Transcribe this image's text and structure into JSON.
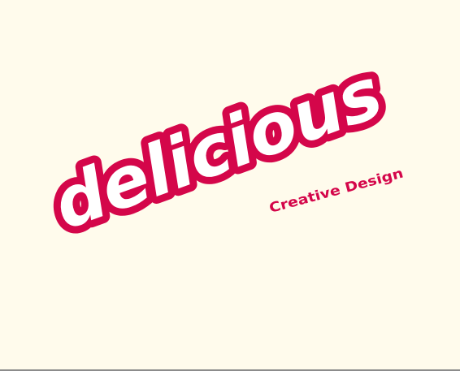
{
  "logo": {
    "wordmark": "delicious",
    "tagline": "Creative Design"
  },
  "colors": {
    "background": "#fffbec",
    "brand": "#d4064a",
    "wordmark_fill": "#ffffff",
    "bottom_rule": "#8c8c8c"
  }
}
